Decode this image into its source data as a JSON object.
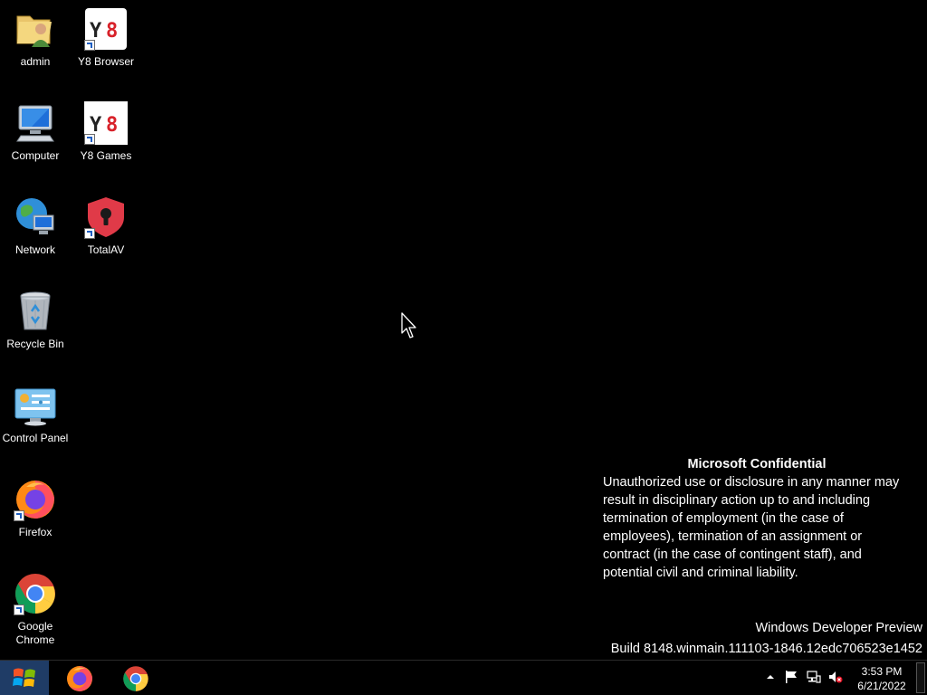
{
  "desktop_icons": [
    {
      "label": "admin",
      "icon": "user-folder-icon",
      "shortcut": false
    },
    {
      "label": "Computer",
      "icon": "computer-icon",
      "shortcut": false
    },
    {
      "label": "Network",
      "icon": "network-globe-icon",
      "shortcut": false
    },
    {
      "label": "Recycle Bin",
      "icon": "recycle-bin-icon",
      "shortcut": false
    },
    {
      "label": "Control Panel",
      "icon": "control-panel-icon",
      "shortcut": false
    },
    {
      "label": "Firefox",
      "icon": "firefox-icon",
      "shortcut": true
    },
    {
      "label": "Google Chrome",
      "icon": "chrome-icon",
      "shortcut": true
    },
    {
      "label": "Y8 Browser",
      "icon": "y8-icon",
      "shortcut": true
    },
    {
      "label": "Y8 Games",
      "icon": "y8-icon",
      "shortcut": true
    },
    {
      "label": "TotalAV",
      "icon": "totalav-shield-icon",
      "shortcut": true
    }
  ],
  "watermark": {
    "title": "Microsoft Confidential",
    "body": "Unauthorized use or disclosure in any manner may result in disciplinary action up to and including termination of employment (in the case of employees), termination of an assignment or contract (in the case of contingent staff), and potential civil and criminal liability."
  },
  "build_info": {
    "line1": "Windows Developer Preview",
    "line2": "Build 8148.winmain.111103-1846.12edc706523e1452"
  },
  "taskbar": {
    "start_icon": "windows-logo-icon",
    "pinned_apps": [
      {
        "name": "Firefox",
        "icon": "firefox-icon"
      },
      {
        "name": "Google Chrome",
        "icon": "chrome-icon"
      }
    ],
    "tray_icons": [
      "chevron-up-icon",
      "action-center-flag-icon",
      "network-icon",
      "volume-muted-icon"
    ],
    "clock": {
      "time": "3:53 PM",
      "date": "6/21/2022"
    }
  },
  "colors": {
    "desktop_background": "#000000",
    "start_button": "#1f3c66",
    "totalav_red": "#e03a48",
    "y8_red": "#d8222a"
  }
}
